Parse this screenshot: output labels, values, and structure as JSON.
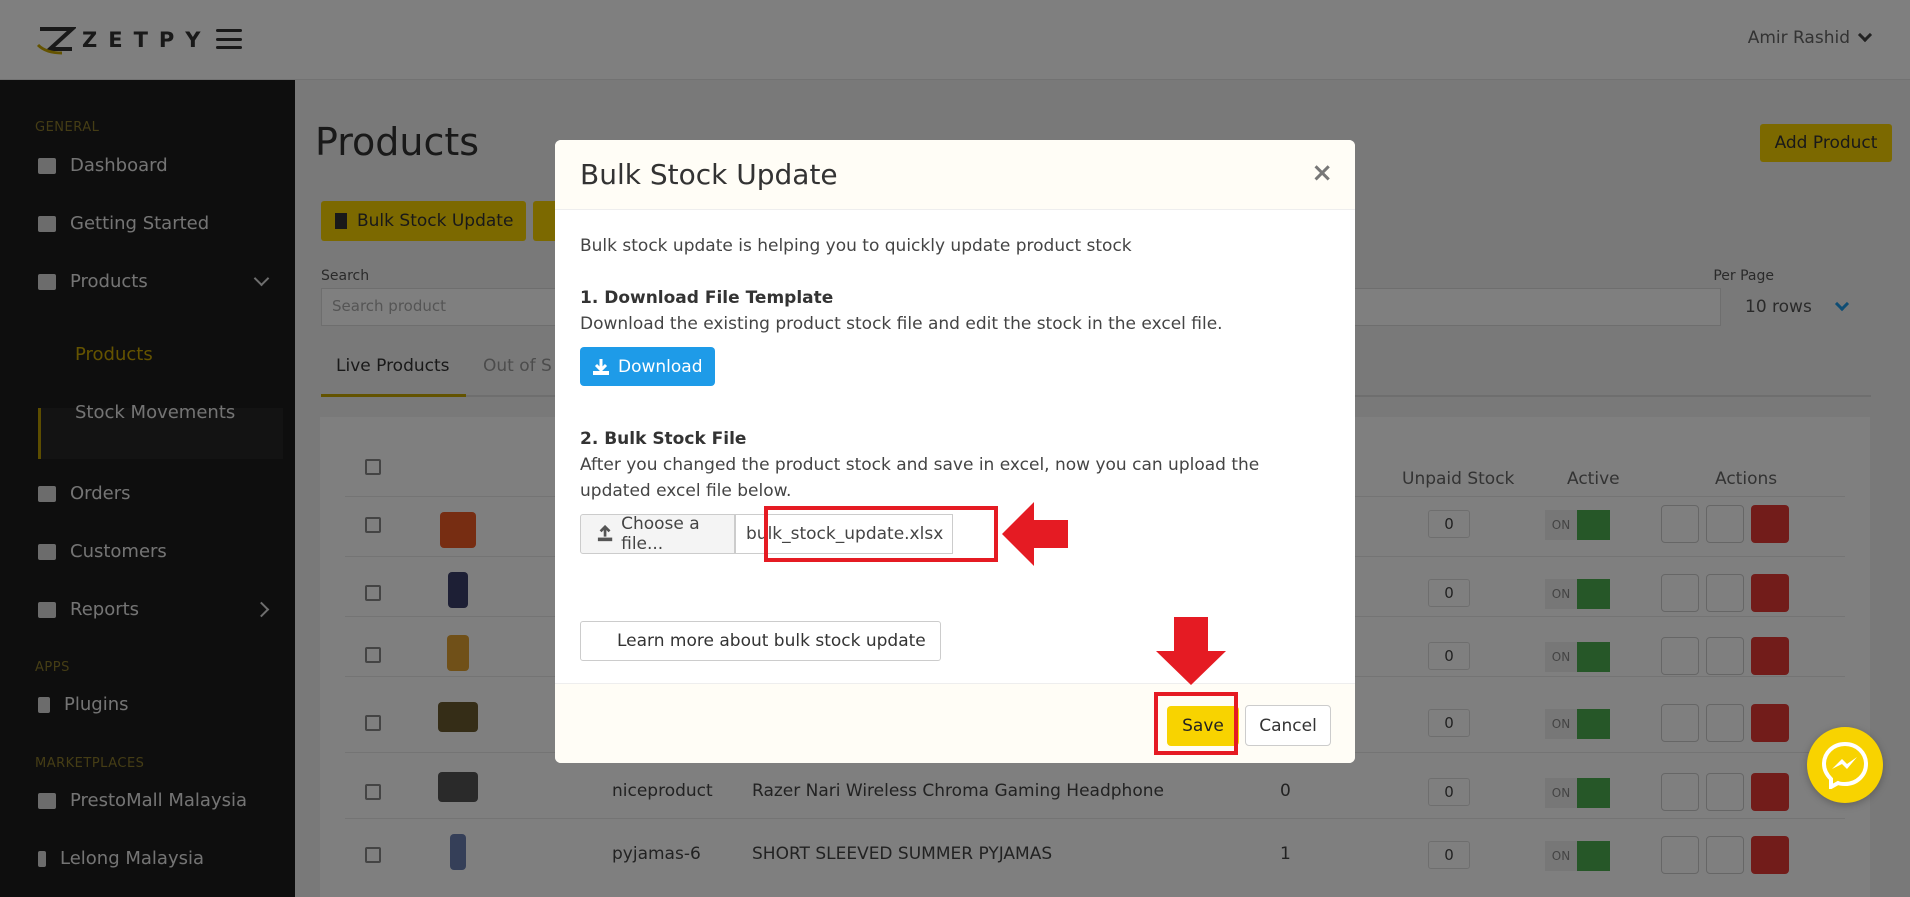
{
  "app": {
    "brand": "ZETPY",
    "user_name": "Amir Rashid"
  },
  "sidebar": {
    "groups": {
      "general": "GENERAL",
      "apps": "APPS",
      "marketplaces": "MARKETPLACES"
    },
    "items": [
      {
        "label": "Dashboard",
        "icon": "home-icon"
      },
      {
        "label": "Getting Started",
        "icon": "book-icon"
      },
      {
        "label": "Products",
        "icon": "boxes-icon"
      },
      {
        "label": "Products",
        "icon": ""
      },
      {
        "label": "Stock Movements",
        "icon": ""
      },
      {
        "label": "Orders",
        "icon": "list-icon"
      },
      {
        "label": "Customers",
        "icon": "users-icon"
      },
      {
        "label": "Reports",
        "icon": "chart-icon"
      },
      {
        "label": "Plugins",
        "icon": "plug-icon"
      },
      {
        "label": "PrestoMall Malaysia",
        "icon": "mall-icon"
      },
      {
        "label": "Lelong Malaysia",
        "icon": "l-icon"
      }
    ]
  },
  "page": {
    "title": "Products",
    "add_product_label": "Add Product",
    "bulk_stock_update_label": "Bulk Stock Update",
    "search_label": "Search",
    "search_placeholder": "Search product",
    "per_page_label": "Per Page",
    "per_page_value": "10 rows",
    "tabs": [
      "Live Products",
      "Out of S"
    ],
    "table_headers": {
      "unpaid_stock": "Unpaid Stock",
      "active": "Active",
      "actions": "Actions"
    },
    "rows": [
      {
        "sku": "",
        "name": "",
        "stock": "",
        "unpaid": "0",
        "toggle": "ON"
      },
      {
        "sku": "",
        "name": "",
        "stock": "",
        "unpaid": "0",
        "toggle": "ON"
      },
      {
        "sku": "",
        "name": "",
        "stock": "",
        "unpaid": "0",
        "toggle": "ON"
      },
      {
        "sku": "",
        "name": "",
        "stock": "",
        "unpaid": "0",
        "toggle": "ON"
      },
      {
        "sku": "niceproduct",
        "name": "Razer Nari Wireless Chroma Gaming Headphone",
        "stock": "0",
        "unpaid": "0",
        "toggle": "ON"
      },
      {
        "sku": "pyjamas-6",
        "name": "SHORT SLEEVED SUMMER PYJAMAS",
        "stock": "1",
        "unpaid": "0",
        "toggle": "ON"
      }
    ]
  },
  "modal": {
    "title": "Bulk Stock Update",
    "close_label": "×",
    "intro": "Bulk stock update is helping you to quickly update product stock",
    "step1_title": "1. Download File Template",
    "step1_text": "Download the existing product stock file and edit the stock in the excel file.",
    "download_label": "Download",
    "step2_title": "2. Bulk Stock File",
    "step2_text": "After you changed the product stock and save in excel, now you can upload the updated excel file below.",
    "choose_file_label": "Choose a file...",
    "file_name": "bulk_stock_update.xlsx",
    "learn_more_label": "Learn more about bulk stock update",
    "save_label": "Save",
    "cancel_label": "Cancel"
  },
  "colors": {
    "accent_yellow": "#f8d300",
    "download_blue": "#1e9be8",
    "highlight_red": "#e51b23",
    "delete_red": "#e53935",
    "toggle_green": "#4caf50"
  }
}
